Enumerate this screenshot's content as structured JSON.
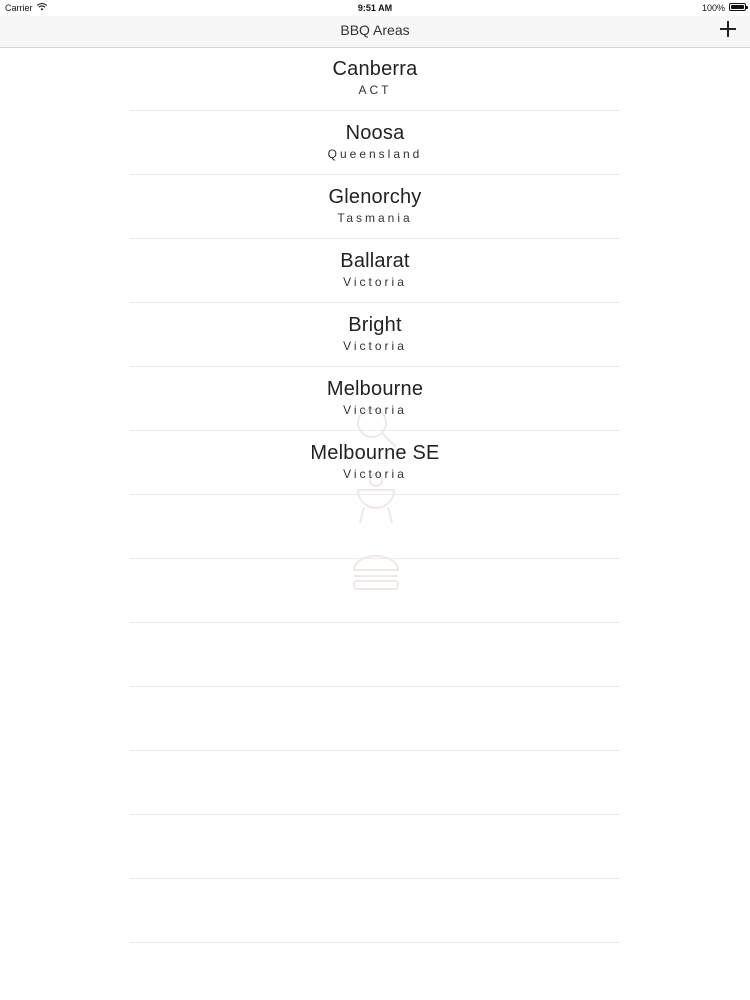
{
  "status_bar": {
    "carrier": "Carrier",
    "time": "9:51 AM",
    "battery": "100%",
    "icons": [
      "wifi-icon",
      "battery-icon"
    ]
  },
  "nav": {
    "title": "BBQ Areas",
    "add_icon": "plus-icon"
  },
  "areas": [
    {
      "name": "Canberra",
      "state": "ACT"
    },
    {
      "name": "Noosa",
      "state": "Queensland"
    },
    {
      "name": "Glenorchy",
      "state": "Tasmania"
    },
    {
      "name": "Ballarat",
      "state": "Victoria"
    },
    {
      "name": "Bright",
      "state": "Victoria"
    },
    {
      "name": "Melbourne",
      "state": "Victoria"
    },
    {
      "name": "Melbourne SE",
      "state": "Victoria"
    }
  ],
  "background_icons": [
    "magnifier-icon",
    "grill-icon",
    "burger-icon"
  ],
  "colors": {
    "nav_background": "#f7f7f8",
    "separator": "#ececee",
    "text": "#222222"
  }
}
